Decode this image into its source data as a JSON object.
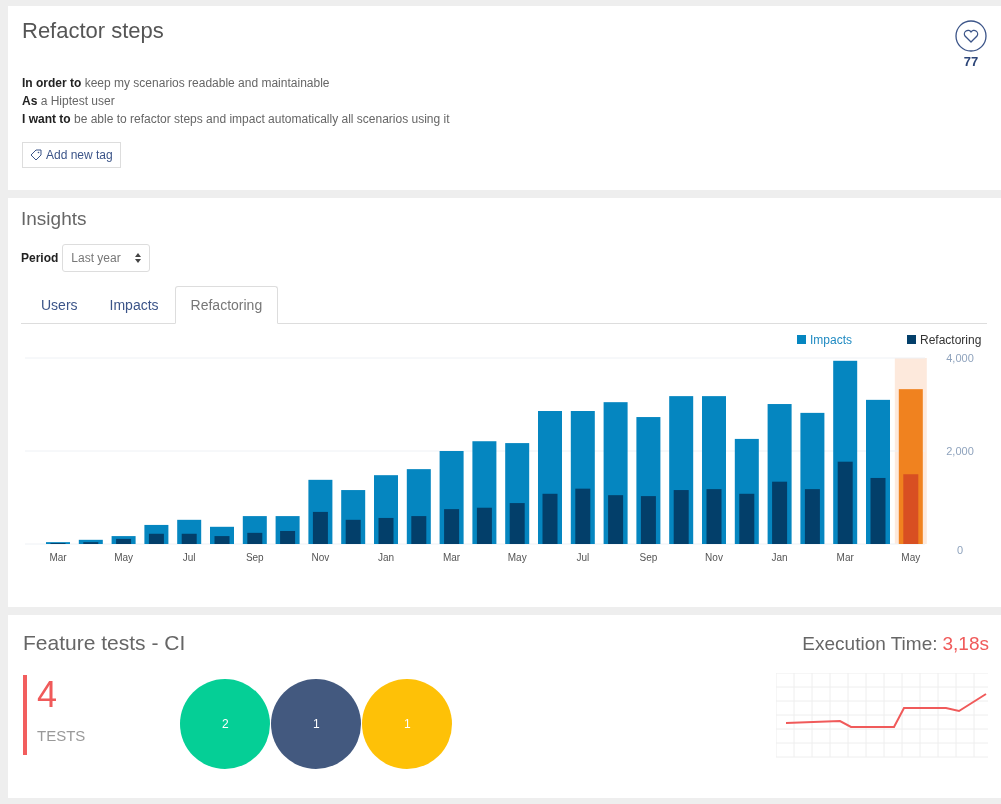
{
  "story": {
    "title": "Refactor steps",
    "likes": "77",
    "lines": [
      {
        "text": "**In order to** keep my scenarios readable and maintainable"
      },
      {
        "text": "**As** a Hiptest user"
      },
      {
        "text": "**I want to** be able to refactor steps and impact automatically all scenarios using it"
      }
    ],
    "tag_button": "Add new tag"
  },
  "insights": {
    "title": "Insights",
    "period_label": "Period",
    "period_value": "Last year",
    "tabs": [
      {
        "label": "Users",
        "selected": false
      },
      {
        "label": "Impacts",
        "selected": false
      },
      {
        "label": "Refactoring",
        "selected": true
      }
    ],
    "chart_data": {
      "type": "bar",
      "stacked": false,
      "categories": [
        "Mar",
        null,
        "May",
        null,
        "Jul",
        null,
        "Sep",
        null,
        "Nov",
        null,
        "Jan",
        null,
        "Mar",
        null,
        "May",
        null,
        "Jul",
        null,
        "Sep",
        null,
        "Nov",
        null,
        "Jan",
        null,
        "Mar",
        null,
        "May"
      ],
      "yticks": [
        {
          "value": 0,
          "label": "0"
        },
        {
          "value": 2000,
          "label": "2,000"
        },
        {
          "value": 4000,
          "label": "4,000"
        }
      ],
      "ylim": [
        0,
        4000
      ],
      "series": [
        {
          "name": "Impacts",
          "color": "#0586c0",
          "colors": [
            "#0586c0",
            "#0586c0",
            "#0586c0",
            "#0586c0",
            "#0586c0",
            "#0586c0",
            "#0586c0",
            "#0586c0",
            "#0586c0",
            "#0586c0",
            "#0586c0",
            "#0586c0",
            "#0586c0",
            "#0586c0",
            "#0586c0",
            "#0586c0",
            "#0586c0",
            "#0586c0",
            "#0586c0",
            "#0586c0",
            "#0586c0",
            "#0586c0",
            "#0586c0",
            "#0586c0",
            "#0586c0",
            "#0586c0",
            "#f0821f"
          ],
          "values": [
            40,
            90,
            170,
            410,
            520,
            370,
            600,
            600,
            1380,
            1160,
            1480,
            1610,
            2000,
            2210,
            2170,
            2860,
            2860,
            3050,
            2730,
            3180,
            3180,
            2260,
            3010,
            2820,
            3940,
            3100,
            3330
          ]
        },
        {
          "name": "Refactoring",
          "color": "#033f6a",
          "colors": [
            "#033f6a",
            "#033f6a",
            "#033f6a",
            "#033f6a",
            "#033f6a",
            "#033f6a",
            "#033f6a",
            "#033f6a",
            "#033f6a",
            "#033f6a",
            "#033f6a",
            "#033f6a",
            "#033f6a",
            "#033f6a",
            "#033f6a",
            "#033f6a",
            "#033f6a",
            "#033f6a",
            "#033f6a",
            "#033f6a",
            "#033f6a",
            "#033f6a",
            "#033f6a",
            "#033f6a",
            "#033f6a",
            "#033f6a",
            "#d84f22"
          ],
          "values": [
            20,
            40,
            110,
            220,
            220,
            170,
            240,
            280,
            690,
            520,
            560,
            600,
            750,
            780,
            880,
            1080,
            1190,
            1050,
            1030,
            1160,
            1180,
            1080,
            1340,
            1180,
            1770,
            1420,
            1500
          ]
        }
      ],
      "legend": true
    }
  },
  "ci": {
    "title": "Feature tests - CI",
    "count": "4",
    "count_label": "TESTS",
    "results": [
      {
        "count": "2",
        "color": "#05cf96"
      },
      {
        "count": "1",
        "color": "#43597f"
      },
      {
        "count": "1",
        "color": "#fec107"
      }
    ],
    "exec_label": "Execution Time:",
    "exec_value": "3,18s"
  }
}
